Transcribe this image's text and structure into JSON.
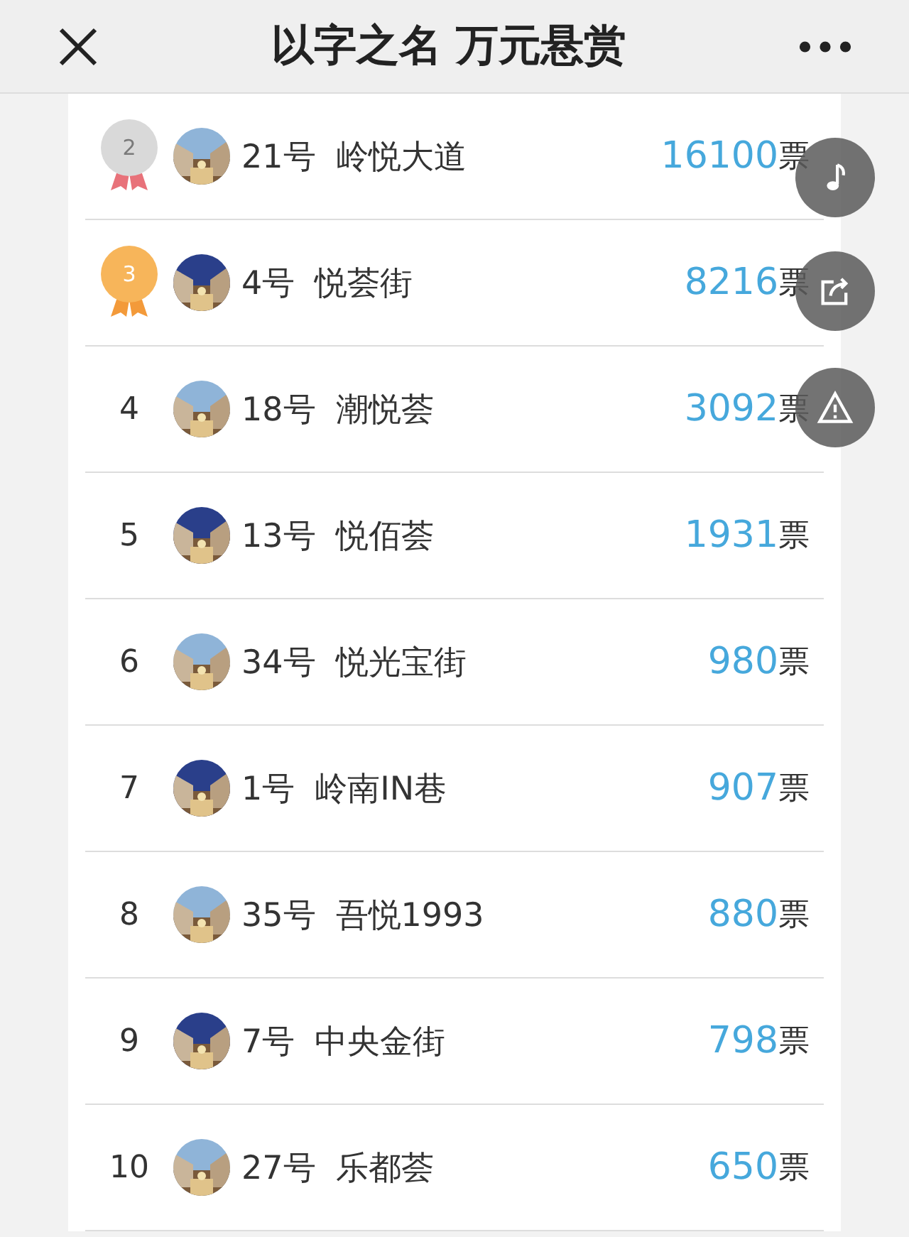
{
  "header": {
    "title": "以字之名 万元悬赏"
  },
  "ranking": [
    {
      "rank": "2",
      "kind": "medal",
      "color": "#d9d9d9",
      "no": "21号",
      "name": "岭悦大道",
      "votes": "16100",
      "unit": "票"
    },
    {
      "rank": "3",
      "kind": "medal",
      "color": "#f7b55a",
      "no": "4号",
      "name": "悦荟街",
      "votes": "8216",
      "unit": "票"
    },
    {
      "rank": "4",
      "kind": "number",
      "no": "18号",
      "name": "潮悦荟",
      "votes": "3092",
      "unit": "票"
    },
    {
      "rank": "5",
      "kind": "number",
      "no": "13号",
      "name": "悦佰荟",
      "votes": "1931",
      "unit": "票"
    },
    {
      "rank": "6",
      "kind": "number",
      "no": "34号",
      "name": "悦光宝街",
      "votes": "980",
      "unit": "票"
    },
    {
      "rank": "7",
      "kind": "number",
      "no": "1号",
      "name": "岭南IN巷",
      "votes": "907",
      "unit": "票"
    },
    {
      "rank": "8",
      "kind": "number",
      "no": "35号",
      "name": "吾悦1993",
      "votes": "880",
      "unit": "票"
    },
    {
      "rank": "9",
      "kind": "number",
      "no": "7号",
      "name": "中央金街",
      "votes": "798",
      "unit": "票"
    },
    {
      "rank": "10",
      "kind": "number",
      "no": "27号",
      "name": "乐都荟",
      "votes": "650",
      "unit": "票"
    }
  ]
}
